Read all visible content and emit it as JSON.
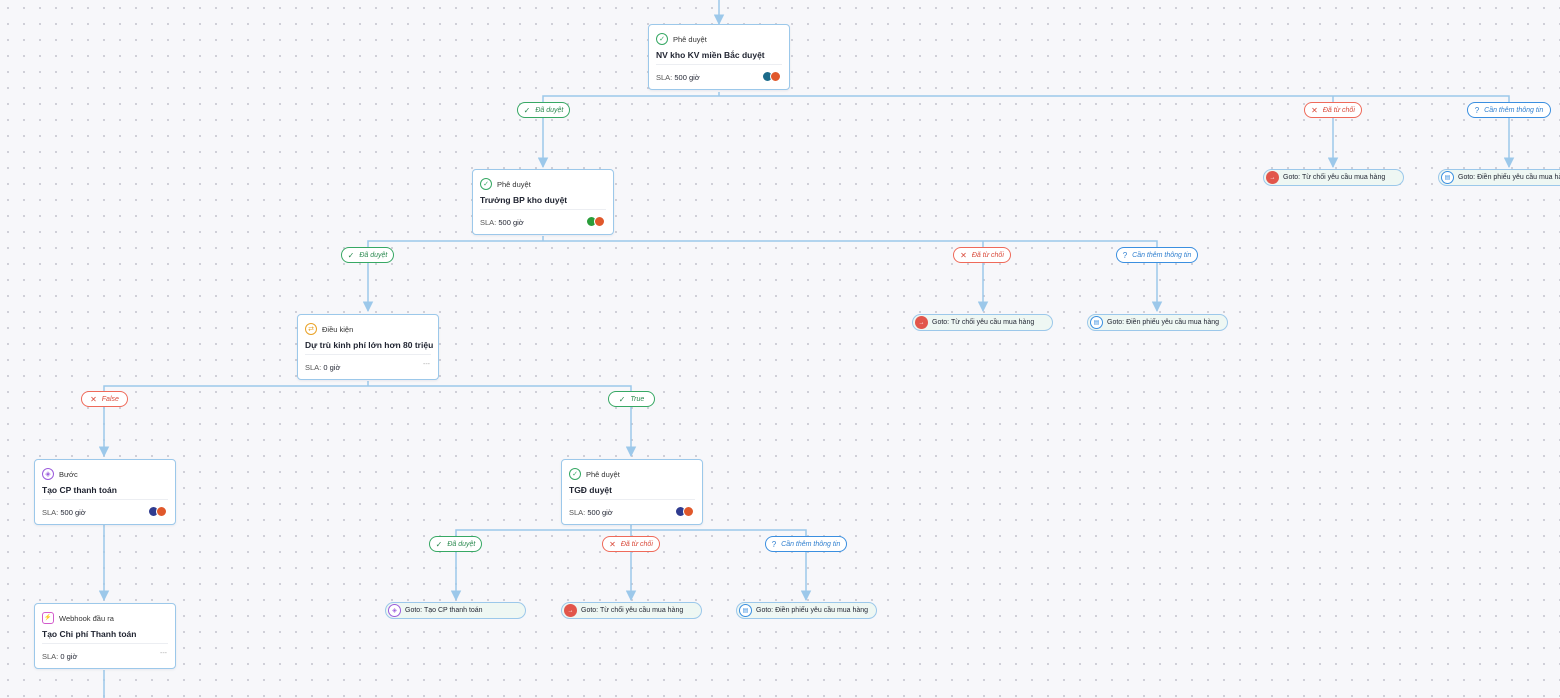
{
  "nodes": {
    "n1": {
      "type": "Phê duyệt",
      "title": "NV kho KV miền Bắc duyệt",
      "sla_label": "SLA:",
      "sla_value": "500 giờ"
    },
    "n2": {
      "type": "Phê duyệt",
      "title": "Trưởng BP kho duyệt",
      "sla_label": "SLA:",
      "sla_value": "500 giờ"
    },
    "n3": {
      "type": "Điều kiện",
      "title": "Dự trù kinh phí lớn hơn 80 triệu",
      "sla_label": "SLA:",
      "sla_value": "0 giờ",
      "placeholder": "---"
    },
    "n4": {
      "type": "Bước",
      "title": "Tạo CP thanh toán",
      "sla_label": "SLA:",
      "sla_value": "500 giờ"
    },
    "n5": {
      "type": "Phê duyệt",
      "title": "TGĐ duyệt",
      "sla_label": "SLA:",
      "sla_value": "500 giờ"
    },
    "n6": {
      "type": "Webhook đầu ra",
      "title": "Tạo Chi phí Thanh toán",
      "sla_label": "SLA:",
      "sla_value": "0 giờ",
      "placeholder": "---"
    }
  },
  "labels": {
    "approved": "Đã duyệt",
    "rejected": "Đã từ chối",
    "need_info": "Cần thêm thông tin",
    "false": "False",
    "true": "True"
  },
  "gotos": {
    "reject": "Goto: Từ chối yêu cầu mua hàng",
    "fill": "Goto: Điền phiếu yêu cầu mua hàng",
    "create_cp": "Goto: Tạo CP thanh toán"
  },
  "icons": {
    "approve": "check-circle-icon",
    "condition": "condition-icon",
    "step": "step-icon",
    "webhook": "webhook-icon"
  },
  "colors": {
    "approved": "#37a864",
    "rejected": "#ef6a5a",
    "info": "#3b8fe0",
    "edge": "#9cc8ea"
  }
}
